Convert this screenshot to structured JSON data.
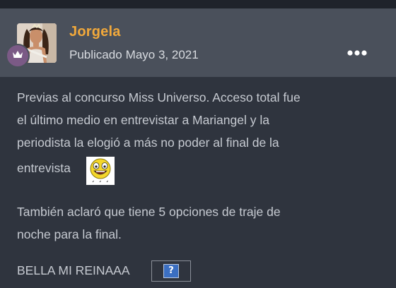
{
  "post": {
    "author": "Jorgela",
    "published_label": "Publicado",
    "published_date": "Mayo 3, 2021",
    "body": {
      "line1": "Previas al concurso Miss Universo. Acceso total fue",
      "line2": "el último medio en entrevistar a Mariangel y la",
      "line3": "periodista la elogió a más no poder al final de la",
      "line4": "entrevista",
      "line5": "También aclaró que tiene 5 opciones de traje de",
      "line6": "noche para la final.",
      "line7": "BELLA MI REINAAA",
      "broken_image_glyph": "?"
    }
  },
  "icons": {
    "rank": "crown-icon",
    "menu": "more-horizontal-icon",
    "emoji": "laughing-emoji-icon"
  },
  "colors": {
    "author": "#f2a93b",
    "header_bg": "#4a505b",
    "body_bg": "#2f343e",
    "badge_bg": "#7b5a86"
  }
}
